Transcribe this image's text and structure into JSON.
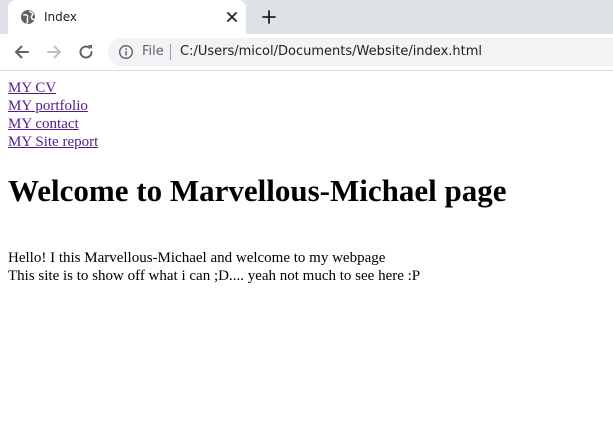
{
  "browser": {
    "tab": {
      "title": "Index",
      "favicon": "globe-icon"
    },
    "toolbar": {
      "back_icon": "arrow-left-icon",
      "forward_icon": "arrow-right-icon",
      "reload_icon": "reload-icon"
    },
    "address_bar": {
      "security_icon": "info-icon",
      "scheme_label": "File",
      "url": "C:/Users/micol/Documents/Website/index.html"
    },
    "colors": {
      "tabstrip_bg": "#dee1e6",
      "omnibox_bg": "#f1f3f4",
      "visited_link": "#551a8b"
    }
  },
  "page": {
    "nav_links": [
      {
        "label": "MY CV"
      },
      {
        "label": "MY portfolio"
      },
      {
        "label": "MY contact"
      },
      {
        "label": "MY Site report"
      }
    ],
    "heading": "Welcome to Marvellous-Michael page",
    "intro_lines": [
      "Hello! I this Marvellous-Michael and welcome to my webpage",
      "This site is to show off what i can ;D.... yeah not much to see here :P"
    ]
  }
}
